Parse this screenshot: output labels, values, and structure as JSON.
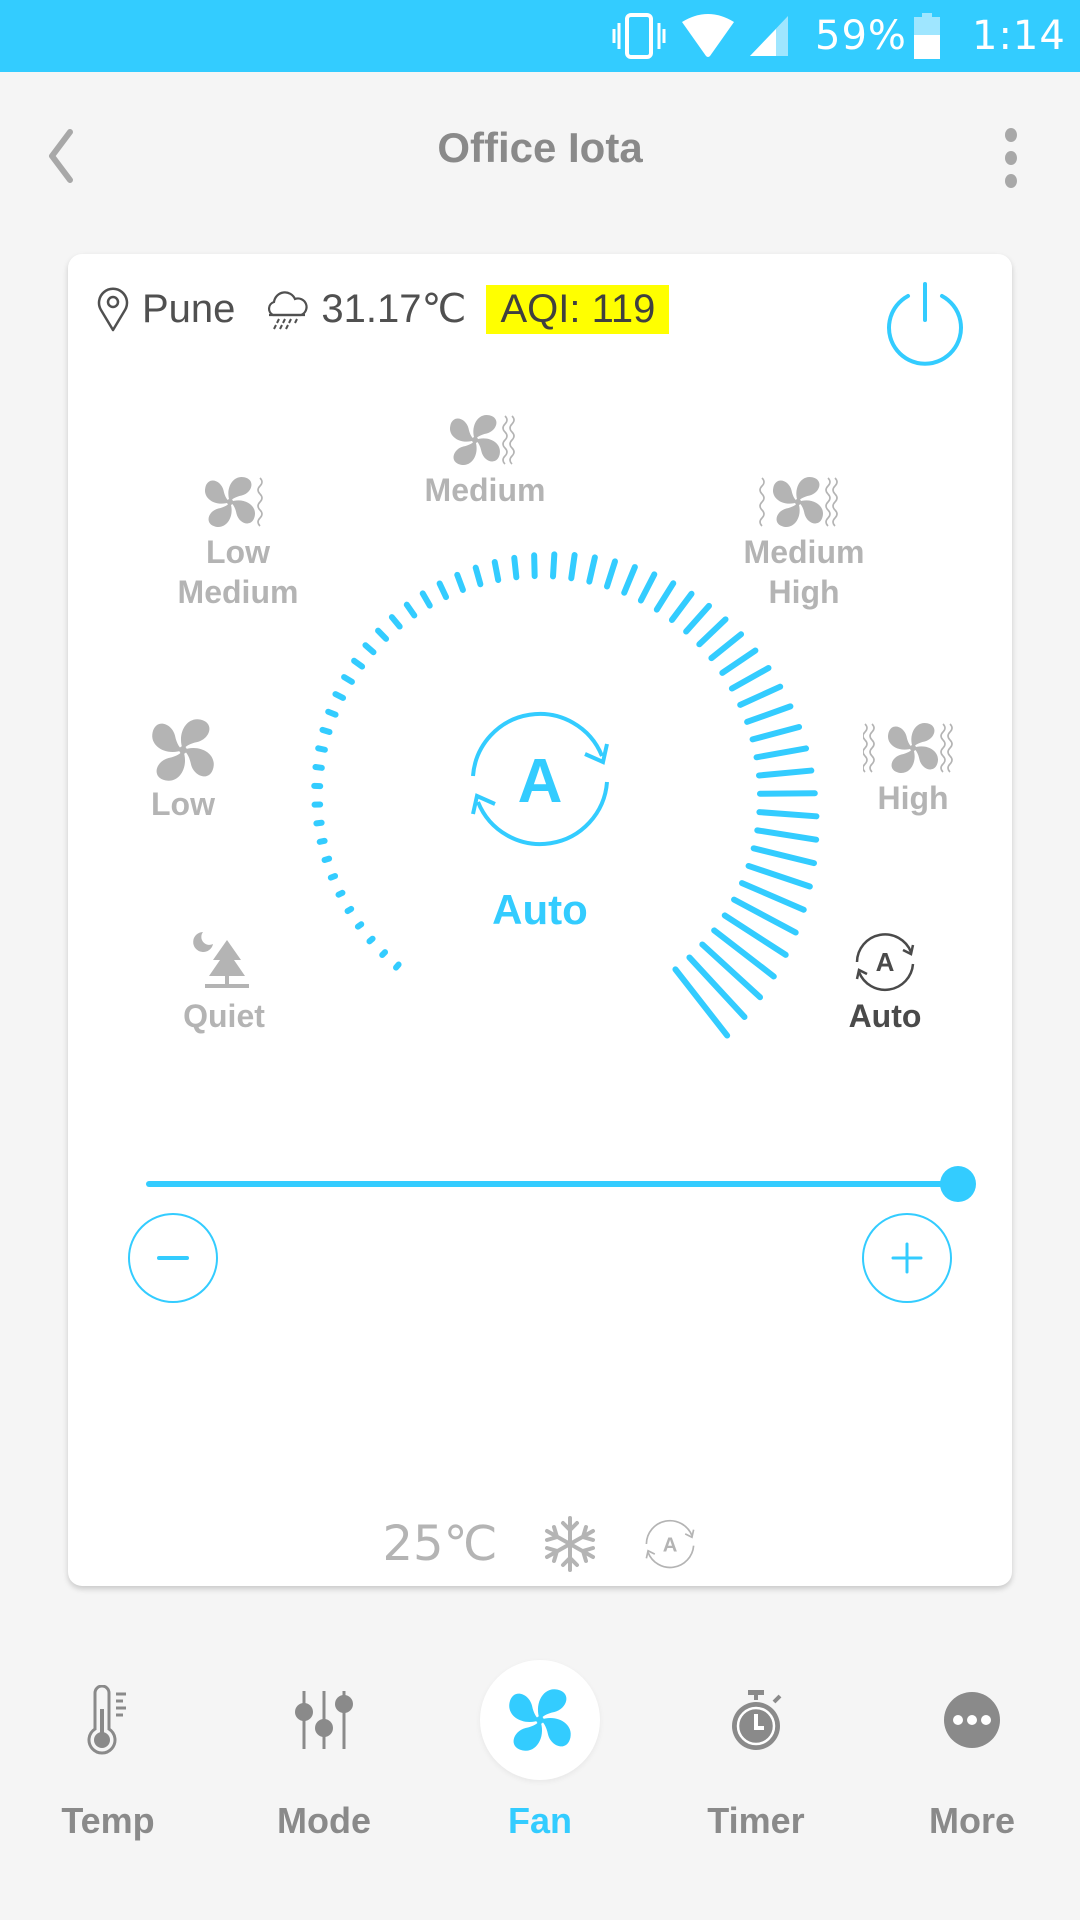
{
  "status_bar": {
    "battery_percent": "59%",
    "time": "1:14",
    "icons": [
      "vibrate-icon",
      "wifi-icon",
      "cell-signal-icon",
      "battery-icon"
    ]
  },
  "header": {
    "title": "Office Iota",
    "back_icon": "chevron-left-icon",
    "menu_icon": "more-vertical-icon"
  },
  "weather": {
    "location": "Pune",
    "temperature": "31.17℃",
    "aqi": "AQI: 119",
    "aqi_color": "#ffff00"
  },
  "power": {
    "icon": "power-icon",
    "color": "#33ccff"
  },
  "fan_modes": [
    {
      "id": "quiet",
      "label": "Quiet",
      "icon": "quiet-night-icon",
      "active": false
    },
    {
      "id": "low",
      "label": "Low",
      "icon": "fan-low-icon",
      "active": false
    },
    {
      "id": "low-medium",
      "label": "Low\nMedium",
      "icon": "fan-low-medium-icon",
      "active": false
    },
    {
      "id": "medium",
      "label": "Medium",
      "icon": "fan-medium-icon",
      "active": false
    },
    {
      "id": "medium-high",
      "label": "Medium\nHigh",
      "icon": "fan-medium-high-icon",
      "active": false
    },
    {
      "id": "high",
      "label": "High",
      "icon": "fan-high-icon",
      "active": false
    },
    {
      "id": "auto",
      "label": "Auto",
      "icon": "auto-icon",
      "active": true
    }
  ],
  "dial": {
    "selected_label": "Auto",
    "level_fraction": 1.0
  },
  "slider": {
    "value_fraction": 1.0
  },
  "buttons": {
    "decrease": "minus-icon",
    "increase": "plus-icon"
  },
  "summary": {
    "set_temperature": "25℃",
    "mode_icon": "snowflake-icon",
    "fan_icon": "auto-icon"
  },
  "bottom_nav": [
    {
      "label": "Temp",
      "icon": "thermometer-icon",
      "active": false
    },
    {
      "label": "Mode",
      "icon": "sliders-icon",
      "active": false
    },
    {
      "label": "Fan",
      "icon": "fan-icon",
      "active": true
    },
    {
      "label": "Timer",
      "icon": "stopwatch-icon",
      "active": false
    },
    {
      "label": "More",
      "icon": "more-horizontal-icon",
      "active": false
    }
  ],
  "colors": {
    "accent": "#33ccff",
    "inactive": "#b4b4b4",
    "nav_inactive": "#8a8a8a",
    "background": "#f5f5f5"
  }
}
